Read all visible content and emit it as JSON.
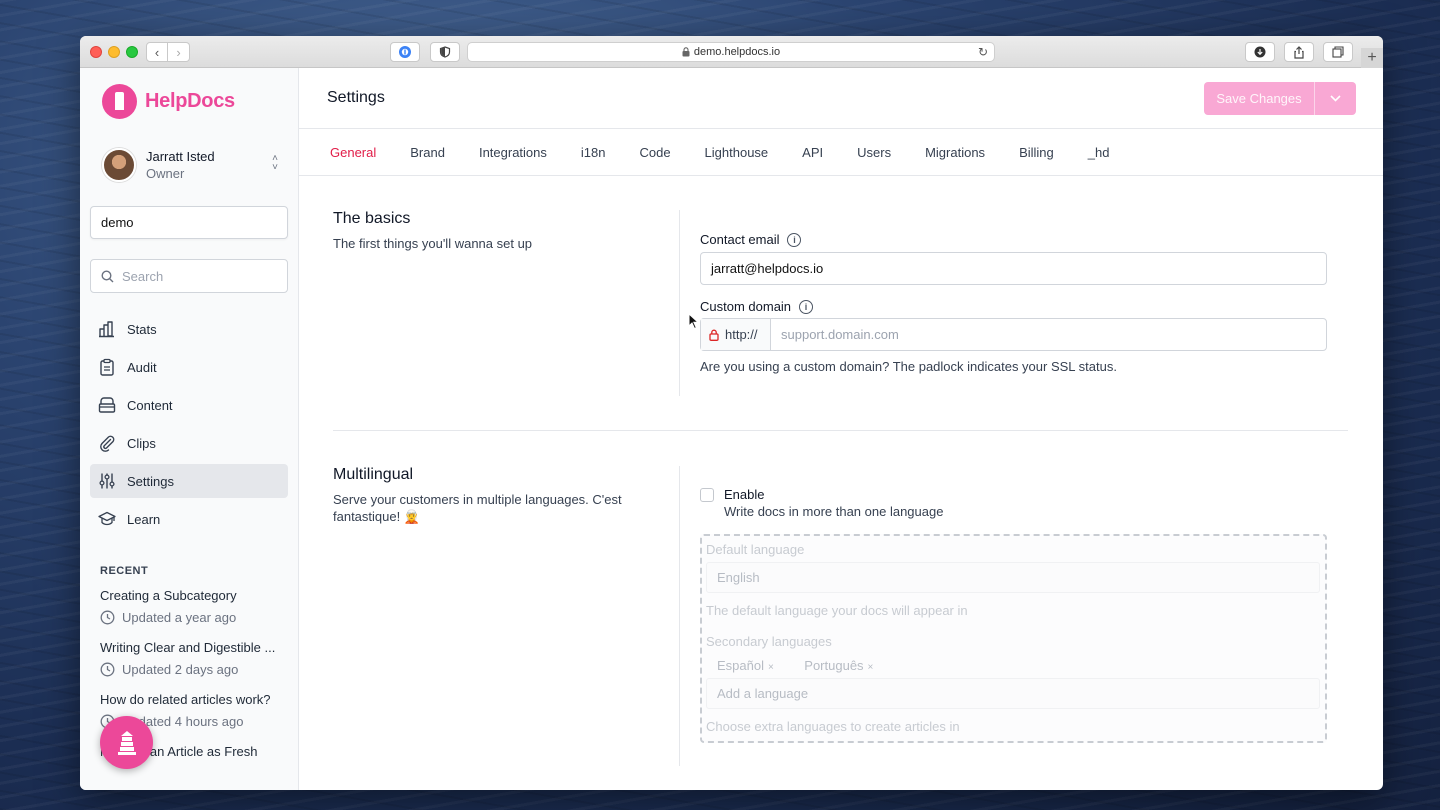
{
  "browser": {
    "url": "demo.helpdocs.io"
  },
  "brand": {
    "name": "HelpDocs",
    "color": "#ec4899"
  },
  "user": {
    "name": "Jarratt Isted",
    "role": "Owner"
  },
  "sidebar": {
    "site_value": "demo",
    "search_placeholder": "Search",
    "nav": [
      {
        "label": "Stats",
        "icon": "chart-bar-icon"
      },
      {
        "label": "Audit",
        "icon": "clipboard-icon"
      },
      {
        "label": "Content",
        "icon": "archive-icon"
      },
      {
        "label": "Clips",
        "icon": "paperclip-icon"
      },
      {
        "label": "Settings",
        "icon": "sliders-icon",
        "active": true
      },
      {
        "label": "Learn",
        "icon": "academic-cap-icon"
      }
    ],
    "recent_heading": "RECENT",
    "recent": [
      {
        "title": "Creating a Subcategory",
        "meta": "Updated a year ago"
      },
      {
        "title": "Writing Clear and Digestible ...",
        "meta": "Updated 2 days ago"
      },
      {
        "title": "How do related articles work?",
        "meta": "Updated 4 hours ago"
      },
      {
        "title": "Marking an Article as Fresh",
        "meta": ""
      }
    ]
  },
  "header": {
    "title": "Settings",
    "save_label": "Save Changes"
  },
  "tabs": [
    "General",
    "Brand",
    "Integrations",
    "i18n",
    "Code",
    "Lighthouse",
    "API",
    "Users",
    "Migrations",
    "Billing",
    "_hd"
  ],
  "basics": {
    "title": "The basics",
    "desc": "The first things you'll wanna set up",
    "contact_label": "Contact email",
    "contact_value": "jarratt@helpdocs.io",
    "domain_label": "Custom domain",
    "domain_prefix": "http://",
    "domain_placeholder": "support.domain.com",
    "domain_help": "Are you using a custom domain? The padlock indicates your SSL status."
  },
  "multilingual": {
    "title": "Multilingual",
    "desc": "Serve your customers in multiple languages. C'est fantastique! 🧝",
    "enable_label": "Enable",
    "enable_help": "Write docs in more than one language",
    "default_label": "Default language",
    "default_value": "English",
    "default_help": "The default language your docs will appear in",
    "secondary_label": "Secondary languages",
    "secondary": [
      "Español",
      "Português"
    ],
    "add_placeholder": "Add a language",
    "secondary_help": "Choose extra languages to create articles in"
  }
}
